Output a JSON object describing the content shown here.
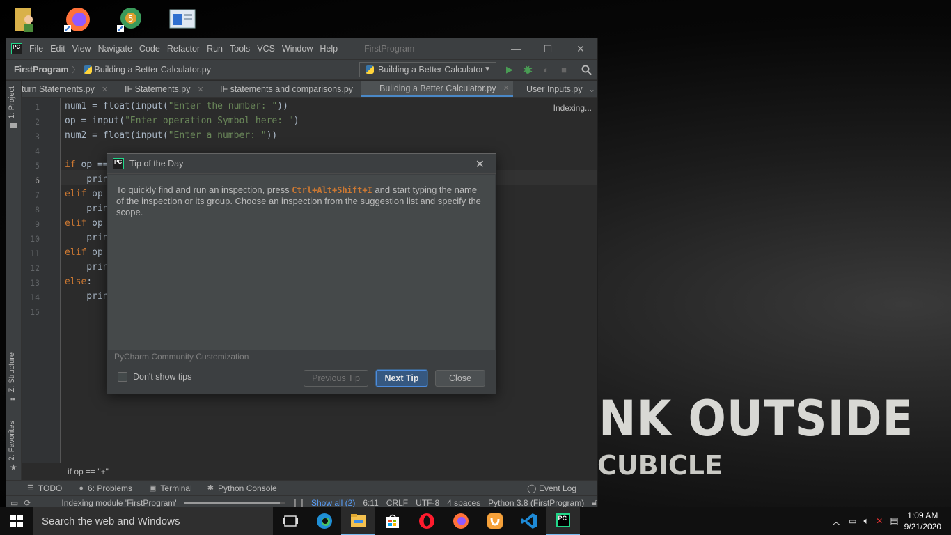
{
  "desktop": {
    "wallpaper_line1": "NK OUTSIDE",
    "wallpaper_line2": "CUBICLE"
  },
  "ide": {
    "logo": "PC",
    "menu": [
      "File",
      "Edit",
      "View",
      "Navigate",
      "Code",
      "Refactor",
      "Run",
      "Tools",
      "VCS",
      "Window",
      "Help"
    ],
    "app_title": "FirstProgram",
    "window_controls": {
      "minimize": "—",
      "maximize": "☐",
      "close": "✕"
    },
    "breadcrumb": {
      "project": "FirstProgram",
      "file": "Building a Better Calculator.py"
    },
    "run_config": "Building a Better Calculator",
    "tabs": [
      {
        "label": "turn Statements.py",
        "active": false
      },
      {
        "label": "IF Statements.py",
        "active": false
      },
      {
        "label": "IF statements and comparisons.py",
        "active": false
      },
      {
        "label": "Building a Better Calculator.py",
        "active": true
      },
      {
        "label": "User Inputs.py",
        "active": false
      }
    ],
    "side_labels": {
      "project": "1: Project",
      "structure": "Z: Structure",
      "favorites": "2: Favorites"
    },
    "indexing": "Indexing...",
    "line_numbers": [
      "1",
      "2",
      "3",
      "4",
      "5",
      "6",
      "7",
      "8",
      "9",
      "10",
      "11",
      "12",
      "13",
      "14",
      "15"
    ],
    "code_breadcrumb": "if op == \"+\"",
    "tool_windows": {
      "todo": "TODO",
      "problems": "6: Problems",
      "terminal": "Terminal",
      "python_console": "Python Console",
      "event_log": "Event Log"
    },
    "status": {
      "indexing_module": "Indexing module 'FirstProgram'",
      "progress": 0.95,
      "show_all": "Show all (2)",
      "position": "6:11",
      "line_sep": "CRLF",
      "encoding": "UTF-8",
      "indent": "4 spaces",
      "interpreter": "Python 3.8 (FirstProgram)"
    }
  },
  "dialog": {
    "title": "Tip of the Day",
    "tip_before": "To quickly find and run an inspection, press ",
    "tip_shortcut": "Ctrl+Alt+Shift+I",
    "tip_after": " and start typing the name of the inspection or its group. Choose an inspection from the suggestion list and specify the scope.",
    "customization": "PyCharm Community Customization",
    "dont_show": "Don't show tips",
    "prev": "Previous Tip",
    "next": "Next Tip",
    "close": "Close"
  },
  "taskbar": {
    "search_placeholder": "Search the web and Windows",
    "time": "1:09 AM",
    "date": "9/21/2020"
  }
}
